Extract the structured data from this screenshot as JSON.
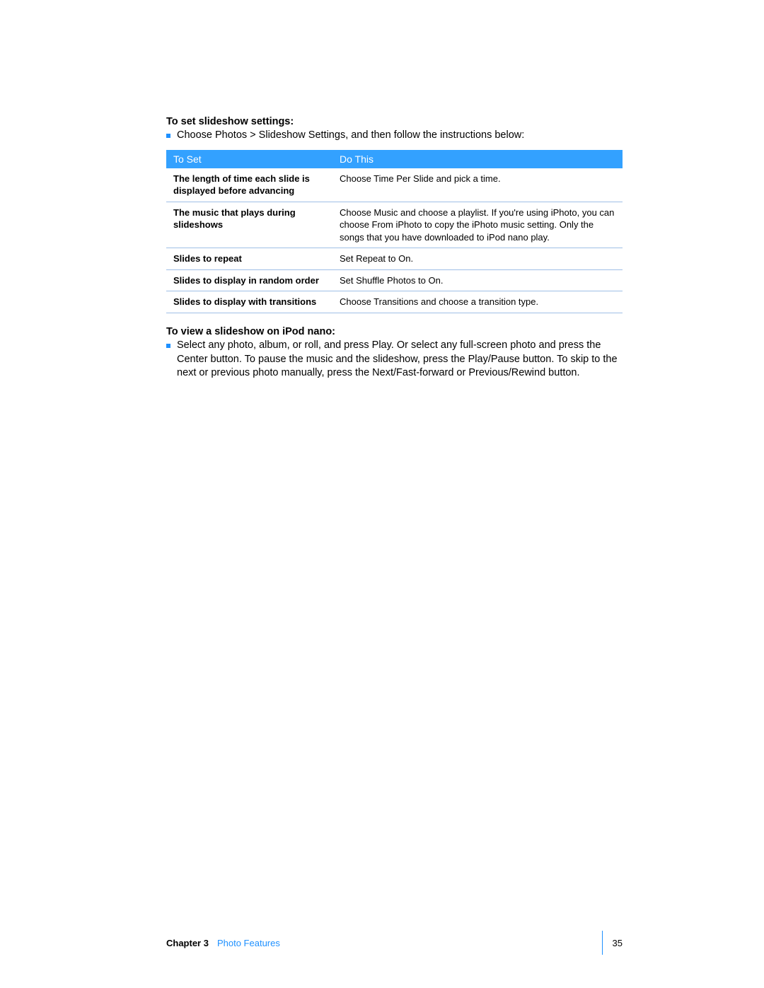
{
  "section1": {
    "heading": "To set slideshow settings:",
    "bullet_text": "Choose Photos > Slideshow Settings, and then follow the instructions below:"
  },
  "table": {
    "headers": {
      "col1": "To Set",
      "col2": "Do This"
    },
    "rows": [
      {
        "set": "The length of time each slide is displayed before advancing",
        "do": "Choose Time Per Slide and pick a time."
      },
      {
        "set": "The music that plays during slideshows",
        "do": "Choose Music and choose a playlist. If you're using iPhoto, you can choose From iPhoto to copy the iPhoto music setting. Only the songs that you have downloaded to iPod nano play."
      },
      {
        "set": "Slides to repeat",
        "do": "Set Repeat to On."
      },
      {
        "set": "Slides to display in random order",
        "do": "Set Shuffle Photos to On."
      },
      {
        "set": "Slides to display with transitions",
        "do": "Choose Transitions and choose a transition type."
      }
    ]
  },
  "section2": {
    "heading": "To view a slideshow on iPod nano:",
    "bullet_text": "Select any photo, album, or roll, and press Play. Or select any full-screen photo and press the Center button. To pause the music and the slideshow, press the Play/Pause button. To skip to the next or previous photo manually, press the Next/Fast-forward or Previous/Rewind button."
  },
  "footer": {
    "chapter_label": "Chapter 3",
    "chapter_title": "Photo Features",
    "page_number": "35"
  }
}
